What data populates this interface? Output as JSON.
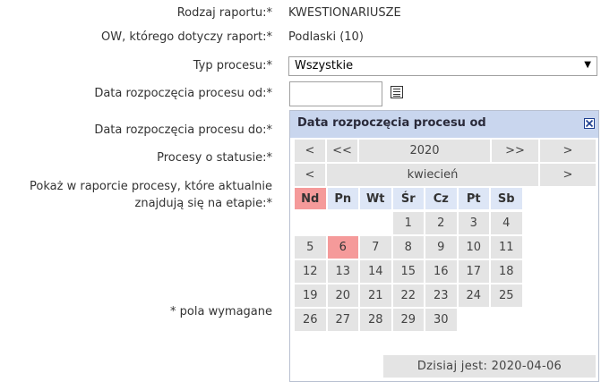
{
  "form": {
    "report_type_label": "Rodzaj raportu:*",
    "report_type_value": "KWESTIONARIUSZE",
    "ow_label": "OW, którego dotyczy raport:*",
    "ow_value": "Podlaski (10)",
    "process_type_label": "Typ procesu:*",
    "process_type_value": "Wszystkie",
    "process_type_arrow": "▼",
    "start_from_label": "Data rozpoczęcia procesu od:*",
    "start_from_value": "",
    "start_to_label": "Data rozpoczęcia procesu do:*",
    "status_label": "Procesy o statusie:*",
    "stage_label_line1": "Pokaż w raporcie procesy, które aktualnie",
    "stage_label_line2": "znajdują się na etapie:*",
    "required_note": "* pola wymagane"
  },
  "calendar": {
    "title": "Data rozpoczęcia procesu od",
    "close_icon": "close-icon",
    "year_nav": {
      "prev": "<",
      "prev_fast": "<<",
      "year": "2020",
      "next_fast": ">>",
      "next": ">"
    },
    "month_nav": {
      "prev": "<",
      "month": "kwiecień",
      "next": ">"
    },
    "weekdays": [
      "Nd",
      "Pn",
      "Wt",
      "Śr",
      "Cz",
      "Pt",
      "Sb"
    ],
    "weeks": [
      [
        "",
        "",
        "",
        "1",
        "2",
        "3",
        "4"
      ],
      [
        "5",
        "6",
        "7",
        "8",
        "9",
        "10",
        "11"
      ],
      [
        "12",
        "13",
        "14",
        "15",
        "16",
        "17",
        "18"
      ],
      [
        "19",
        "20",
        "21",
        "22",
        "23",
        "24",
        "25"
      ],
      [
        "26",
        "27",
        "28",
        "29",
        "30",
        "",
        ""
      ]
    ],
    "today_day": "6",
    "today_text": "Dzisiaj jest: 2020-04-06",
    "colors": {
      "title_bg": "#c9d6ee",
      "weekday_bg": "#dde6f6",
      "highlight": "#f59a9a",
      "cell_bg": "#e4e4e4"
    }
  }
}
